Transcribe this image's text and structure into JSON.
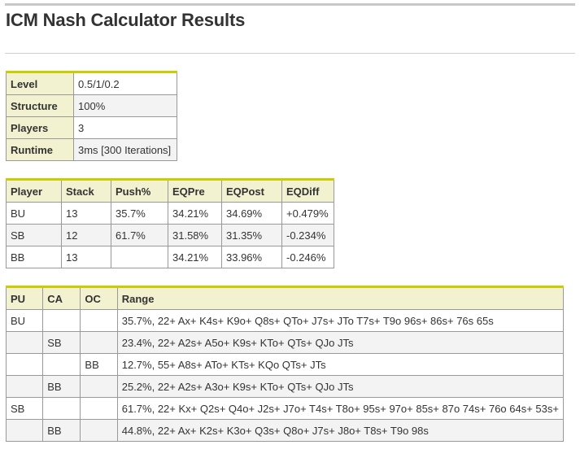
{
  "page": {
    "title": "ICM Nash Calculator Results"
  },
  "info": [
    {
      "label": "Level",
      "value": "0.5/1/0.2"
    },
    {
      "label": "Structure",
      "value": "100%"
    },
    {
      "label": "Players",
      "value": "3"
    },
    {
      "label": "Runtime",
      "value": "3ms [300 Iterations]"
    }
  ],
  "players": {
    "headers": [
      "Player",
      "Stack",
      "Push%",
      "EQPre",
      "EQPost",
      "EQDiff"
    ],
    "rows": [
      [
        "BU",
        "13",
        "35.7%",
        "34.21%",
        "34.69%",
        "+0.479%"
      ],
      [
        "SB",
        "12",
        "61.7%",
        "31.58%",
        "31.35%",
        "-0.234%"
      ],
      [
        "BB",
        "13",
        "",
        "34.21%",
        "33.96%",
        "-0.246%"
      ]
    ]
  },
  "ranges": {
    "headers": [
      "PU",
      "CA",
      "OC",
      "Range"
    ],
    "rows": [
      [
        "BU",
        "",
        "",
        "35.7%, 22+ Ax+ K4s+ K9o+ Q8s+ QTo+ J7s+ JTo T7s+ T9o 96s+ 86s+ 76s 65s"
      ],
      [
        "",
        "SB",
        "",
        "23.4%, 22+ A2s+ A5o+ K9s+ KTo+ QTs+ QJo JTs"
      ],
      [
        "",
        "",
        "BB",
        "12.7%, 55+ A8s+ ATo+ KTs+ KQo QTs+ JTs"
      ],
      [
        "",
        "BB",
        "",
        "25.2%, 22+ A2s+ A3o+ K9s+ KTo+ QTs+ QJo JTs"
      ],
      [
        "SB",
        "",
        "",
        "61.7%, 22+ Kx+ Q2s+ Q4o+ J2s+ J7o+ T4s+ T8o+ 95s+ 97o+ 85s+ 87o 74s+ 76o 64s+ 53s+"
      ],
      [
        "",
        "BB",
        "",
        "44.8%, 22+ Ax+ K2s+ K3o+ Q3s+ Q8o+ J7s+ J8o+ T8s+ T9o 98s"
      ]
    ]
  }
}
